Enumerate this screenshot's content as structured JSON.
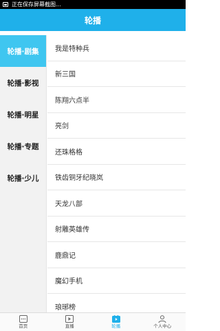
{
  "status_bar": {
    "text": "正在保存屏幕截图..."
  },
  "header": {
    "title": "轮播"
  },
  "sidebar": {
    "items": [
      {
        "label": "轮播·剧集",
        "active": true
      },
      {
        "label": "轮播·影视",
        "active": false
      },
      {
        "label": "轮播·明星",
        "active": false
      },
      {
        "label": "轮播·专题",
        "active": false
      },
      {
        "label": "轮播·少儿",
        "active": false
      }
    ]
  },
  "list": {
    "items": [
      "我是特种兵",
      "新三国",
      "陈翔六点半",
      "亮剑",
      "还珠格格",
      "铁齿铜牙纪晓岚",
      "天龙八部",
      "射雕英雄传",
      "鹿鼎记",
      "魔幻手机",
      "琅琊榜"
    ]
  },
  "tabs": [
    {
      "label": "首页",
      "icon": "home-icon",
      "active": false
    },
    {
      "label": "直播",
      "icon": "live-tv-icon",
      "active": false
    },
    {
      "label": "轮播",
      "icon": "carousel-icon",
      "active": true
    },
    {
      "label": "个人中心",
      "icon": "person-icon",
      "active": false
    }
  ],
  "colors": {
    "accent": "#1fb0ea",
    "sidebar_active": "#3fc6f0",
    "sidebar_bg": "#f2f2f2"
  }
}
